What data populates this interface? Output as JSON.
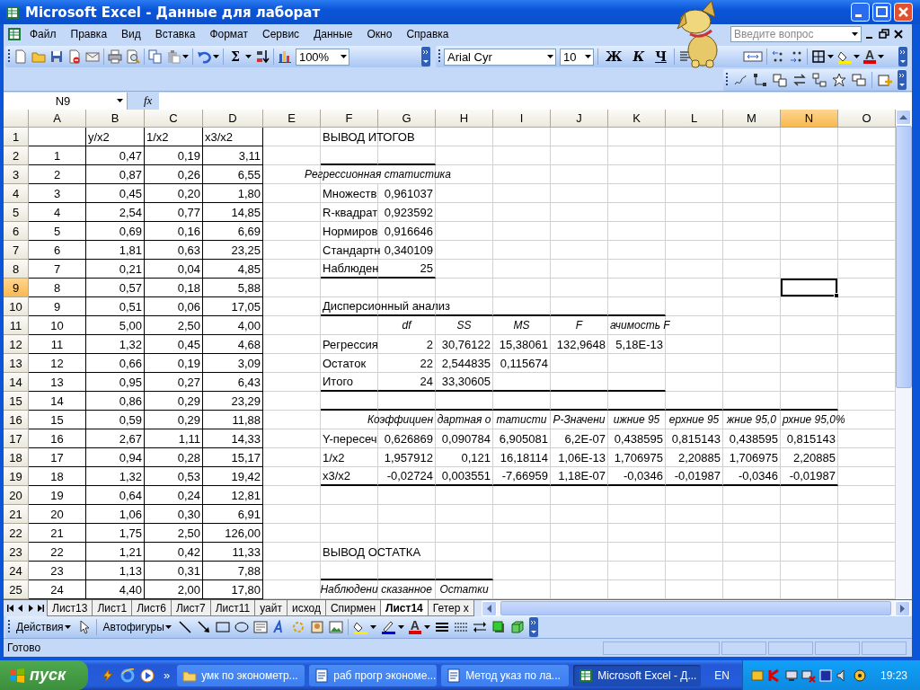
{
  "window": {
    "title": "Microsoft Excel - Данные для лаборат"
  },
  "menu": [
    "Файл",
    "Правка",
    "Вид",
    "Вставка",
    "Формат",
    "Сервис",
    "Данные",
    "Окно",
    "Справка"
  ],
  "help_search": {
    "placeholder": "Введите вопрос"
  },
  "standard_toolbar": {
    "paste_disabled": true,
    "sum": "Σ",
    "zoom": "100%"
  },
  "formatting_toolbar": {
    "font": "Arial Cyr",
    "size": "10",
    "bold": "Ж",
    "italic": "К",
    "underline": "Ч",
    "font_color": "A"
  },
  "formula_bar": {
    "name_box": "N9",
    "fx": "fx"
  },
  "columns": [
    {
      "label": "A",
      "selected": false,
      "boxed": true
    },
    {
      "label": "B",
      "selected": false,
      "boxed": true
    },
    {
      "label": "C",
      "selected": false,
      "boxed": true
    },
    {
      "label": "D",
      "selected": false,
      "boxed": true
    },
    {
      "label": "E",
      "selected": false,
      "boxed": false
    },
    {
      "label": "F",
      "selected": false,
      "boxed": false
    },
    {
      "label": "G",
      "selected": false,
      "boxed": false
    },
    {
      "label": "H",
      "selected": false,
      "boxed": false
    },
    {
      "label": "I",
      "selected": false,
      "boxed": false
    },
    {
      "label": "J",
      "selected": false,
      "boxed": false
    },
    {
      "label": "K",
      "selected": false,
      "boxed": false
    },
    {
      "label": "L",
      "selected": false,
      "boxed": false
    },
    {
      "label": "M",
      "selected": false,
      "boxed": false
    },
    {
      "label": "N",
      "selected": true,
      "boxed": false
    },
    {
      "label": "O",
      "selected": false,
      "boxed": false
    }
  ],
  "rows": [
    {
      "header": "1",
      "selected": false,
      "cells": {
        "B": {
          "text": "y/x2",
          "kind": "text"
        },
        "C": {
          "text": "1/x2",
          "kind": "text"
        },
        "D": {
          "text": "x3/x2",
          "kind": "text"
        },
        "F": {
          "text": "ВЫВОД ИТОГОВ",
          "kind": "text"
        }
      }
    },
    {
      "header": "2",
      "selected": false,
      "cells": {
        "A": {
          "text": "1",
          "kind": "center"
        },
        "B": "0,47",
        "C": "0,19",
        "D": "3,11"
      },
      "rule_below": {
        "F": true,
        "G": true
      }
    },
    {
      "header": "3",
      "selected": false,
      "cells": {
        "A": {
          "text": "2",
          "kind": "center"
        },
        "B": "0,87",
        "C": "0,26",
        "D": "6,55",
        "F": {
          "text": "Регрессионная статистика",
          "kind": "caption"
        }
      }
    },
    {
      "header": "4",
      "selected": false,
      "cells": {
        "A": {
          "text": "3",
          "kind": "center"
        },
        "B": "0,45",
        "C": "0,20",
        "D": "1,80",
        "F": {
          "text": "Множеств",
          "kind": "text"
        },
        "G": "0,961037"
      }
    },
    {
      "header": "5",
      "selected": false,
      "cells": {
        "A": {
          "text": "4",
          "kind": "center"
        },
        "B": "2,54",
        "C": "0,77",
        "D": "14,85",
        "F": {
          "text": "R-квадрат",
          "kind": "text"
        },
        "G": "0,923592"
      }
    },
    {
      "header": "6",
      "selected": false,
      "cells": {
        "A": {
          "text": "5",
          "kind": "center"
        },
        "B": "0,69",
        "C": "0,16",
        "D": "6,69",
        "F": {
          "text": "Нормиров",
          "kind": "text"
        },
        "G": "0,916646"
      }
    },
    {
      "header": "7",
      "selected": false,
      "cells": {
        "A": {
          "text": "6",
          "kind": "center"
        },
        "B": "1,81",
        "C": "0,63",
        "D": "23,25",
        "F": {
          "text": "Стандартн",
          "kind": "text"
        },
        "G": "0,340109"
      }
    },
    {
      "header": "8",
      "selected": false,
      "cells": {
        "A": {
          "text": "7",
          "kind": "center"
        },
        "B": "0,21",
        "C": "0,04",
        "D": "4,85",
        "F": {
          "text": "Наблюден",
          "kind": "text"
        },
        "G": "25"
      },
      "rule_below": {
        "F": true,
        "G": true
      }
    },
    {
      "header": "9",
      "selected": true,
      "cells": {
        "A": {
          "text": "8",
          "kind": "center"
        },
        "B": "0,57",
        "C": "0,18",
        "D": "5,88"
      }
    },
    {
      "header": "10",
      "selected": false,
      "cells": {
        "A": {
          "text": "9",
          "kind": "center"
        },
        "B": "0,51",
        "C": "0,06",
        "D": "17,05",
        "F": {
          "text": "Дисперсионный анализ",
          "kind": "text"
        }
      },
      "rule_below": {
        "F": true,
        "G": true,
        "H": true,
        "I": true,
        "J": true,
        "K": true
      }
    },
    {
      "header": "11",
      "selected": false,
      "cells": {
        "A": {
          "text": "10",
          "kind": "center"
        },
        "B": "5,00",
        "C": "2,50",
        "D": "4,00",
        "G": {
          "text": "df",
          "kind": "italic"
        },
        "H": {
          "text": "SS",
          "kind": "italic"
        },
        "I": {
          "text": "MS",
          "kind": "italic"
        },
        "J": {
          "text": "F",
          "kind": "italic"
        },
        "K": {
          "text": "ачимость F",
          "kind": "italic-left"
        }
      }
    },
    {
      "header": "12",
      "selected": false,
      "cells": {
        "A": {
          "text": "11",
          "kind": "center"
        },
        "B": "1,32",
        "C": "0,45",
        "D": "4,68",
        "F": {
          "text": "Регрессия",
          "kind": "text"
        },
        "G": "2",
        "H": "30,76122",
        "I": "15,38061",
        "J": "132,9648",
        "K": "5,18E-13"
      }
    },
    {
      "header": "13",
      "selected": false,
      "cells": {
        "A": {
          "text": "12",
          "kind": "center"
        },
        "B": "0,66",
        "C": "0,19",
        "D": "3,09",
        "F": {
          "text": "Остаток",
          "kind": "text"
        },
        "G": "22",
        "H": "2,544835",
        "I": "0,115674"
      }
    },
    {
      "header": "14",
      "selected": false,
      "cells": {
        "A": {
          "text": "13",
          "kind": "center"
        },
        "B": "0,95",
        "C": "0,27",
        "D": "6,43",
        "F": {
          "text": "Итого",
          "kind": "text"
        },
        "G": "24",
        "H": "33,30605"
      },
      "rule_below": {
        "F": true,
        "G": true,
        "H": true,
        "I": true,
        "J": true,
        "K": true
      }
    },
    {
      "header": "15",
      "selected": false,
      "cells": {
        "A": {
          "text": "14",
          "kind": "center"
        },
        "B": "0,86",
        "C": "0,29",
        "D": "23,29"
      },
      "rule_below": {
        "F": true,
        "G": true,
        "H": true,
        "I": true,
        "J": true,
        "K": true,
        "L": true,
        "M": true,
        "N": true
      }
    },
    {
      "header": "16",
      "selected": false,
      "cells": {
        "A": {
          "text": "15",
          "kind": "center"
        },
        "B": "0,59",
        "C": "0,29",
        "D": "11,88",
        "G": {
          "text": "Коэффициен",
          "kind": "italic-right"
        },
        "H": {
          "text": "дартная о",
          "kind": "italic"
        },
        "I": {
          "text": "татисти",
          "kind": "italic"
        },
        "J": {
          "text": "P-Значени",
          "kind": "italic"
        },
        "K": {
          "text": "ижние 95",
          "kind": "italic"
        },
        "L": {
          "text": "ерхние 95",
          "kind": "italic"
        },
        "M": {
          "text": "жние 95,0",
          "kind": "italic"
        },
        "N": {
          "text": "рхние 95,0%",
          "kind": "italic-left"
        }
      }
    },
    {
      "header": "17",
      "selected": false,
      "cells": {
        "A": {
          "text": "16",
          "kind": "center"
        },
        "B": "2,67",
        "C": "1,11",
        "D": "14,33",
        "F": {
          "text": "Y-пересеч",
          "kind": "text"
        },
        "G": "0,626869",
        "H": "0,090784",
        "I": "6,905081",
        "J": "6,2E-07",
        "K": "0,438595",
        "L": "0,815143",
        "M": "0,438595",
        "N": "0,815143"
      }
    },
    {
      "header": "18",
      "selected": false,
      "cells": {
        "A": {
          "text": "17",
          "kind": "center"
        },
        "B": "0,94",
        "C": "0,28",
        "D": "15,17",
        "F": {
          "text": "1/x2",
          "kind": "text"
        },
        "G": "1,957912",
        "H": "0,121",
        "I": "16,18114",
        "J": "1,06E-13",
        "K": "1,706975",
        "L": "2,20885",
        "M": "1,706975",
        "N": "2,20885"
      }
    },
    {
      "header": "19",
      "selected": false,
      "cells": {
        "A": {
          "text": "18",
          "kind": "center"
        },
        "B": "1,32",
        "C": "0,53",
        "D": "19,42",
        "F": {
          "text": "x3/x2",
          "kind": "text"
        },
        "G": "-0,02724",
        "H": "0,003551",
        "I": "-7,66959",
        "J": "1,18E-07",
        "K": "-0,0346",
        "L": "-0,01987",
        "M": "-0,0346",
        "N": "-0,01987"
      },
      "rule_below": {
        "F": true,
        "G": true,
        "H": true,
        "I": true,
        "J": true,
        "K": true,
        "L": true,
        "M": true,
        "N": true
      }
    },
    {
      "header": "20",
      "selected": false,
      "cells": {
        "A": {
          "text": "19",
          "kind": "center"
        },
        "B": "0,64",
        "C": "0,24",
        "D": "12,81"
      }
    },
    {
      "header": "21",
      "selected": false,
      "cells": {
        "A": {
          "text": "20",
          "kind": "center"
        },
        "B": "1,06",
        "C": "0,30",
        "D": "6,91"
      }
    },
    {
      "header": "22",
      "selected": false,
      "cells": {
        "A": {
          "text": "21",
          "kind": "center"
        },
        "B": "1,75",
        "C": "2,50",
        "D": "126,00"
      }
    },
    {
      "header": "23",
      "selected": false,
      "cells": {
        "A": {
          "text": "22",
          "kind": "center"
        },
        "B": "1,21",
        "C": "0,42",
        "D": "11,33",
        "F": {
          "text": "ВЫВОД ОСТАТКА",
          "kind": "text"
        }
      }
    },
    {
      "header": "24",
      "selected": false,
      "cells": {
        "A": {
          "text": "23",
          "kind": "center"
        },
        "B": "1,13",
        "C": "0,31",
        "D": "7,88"
      },
      "rule_below": {
        "F": true,
        "G": true,
        "H": true
      }
    },
    {
      "header": "25",
      "selected": false,
      "cells": {
        "A": {
          "text": "24",
          "kind": "center"
        },
        "B": "4,40",
        "C": "2,00",
        "D": "17,80",
        "F": {
          "text": "Наблюдени",
          "kind": "italic"
        },
        "G": {
          "text": "сказанное",
          "kind": "italic"
        },
        "H": {
          "text": "Остатки",
          "kind": "italic"
        }
      }
    }
  ],
  "sheet_tabs": [
    {
      "label": "Лист13",
      "selected": false
    },
    {
      "label": "Лист1",
      "selected": false
    },
    {
      "label": "Лист6",
      "selected": false
    },
    {
      "label": "Лист7",
      "selected": false
    },
    {
      "label": "Лист11",
      "selected": false
    },
    {
      "label": "уайт",
      "selected": false
    },
    {
      "label": "исход",
      "selected": false
    },
    {
      "label": "Спирмен",
      "selected": false
    },
    {
      "label": "Лист14",
      "selected": true
    },
    {
      "label": "Гетер х",
      "selected": false
    }
  ],
  "drawing_toolbar": {
    "actions": "Действия",
    "autoshapes": "Автофигуры",
    "font_color": "A"
  },
  "status_bar": {
    "text": "Готово"
  },
  "taskbar": {
    "start": "пуск",
    "more": "»",
    "tasks": [
      {
        "label": "умк по эконометр...",
        "kind": "folder",
        "selected": false
      },
      {
        "label": "раб прогр экономе...",
        "kind": "word",
        "selected": false
      },
      {
        "label": "Метод указ по ла...",
        "kind": "word",
        "selected": false
      },
      {
        "label": "Microsoft Excel - Д...",
        "kind": "excel",
        "selected": true
      }
    ],
    "language": "EN",
    "clock": "19:23"
  }
}
